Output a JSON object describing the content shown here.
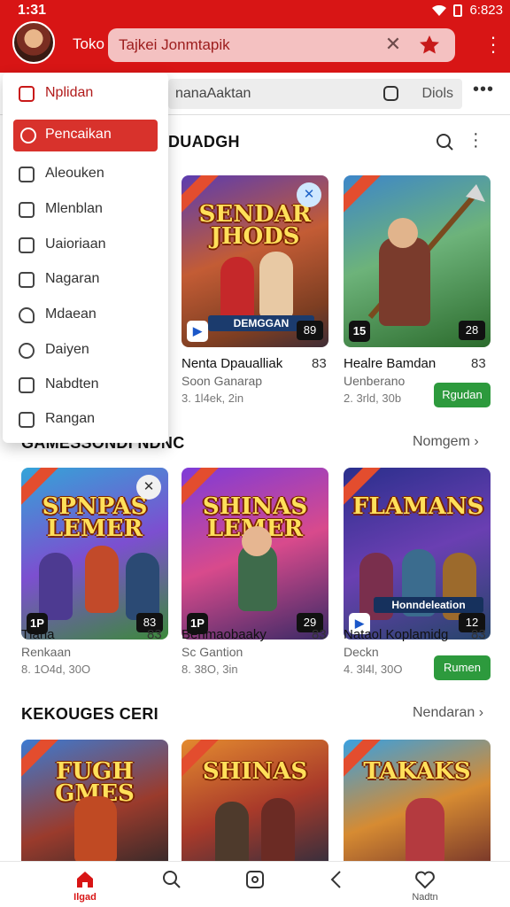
{
  "status": {
    "time": "1:31",
    "battery": "6:823"
  },
  "header": {
    "title": "Toko",
    "search_value": "Tajkei Jonmtapik",
    "clear_icon": "close-icon",
    "action_icon": "bookmark-star-icon"
  },
  "toolbar2": {
    "filter_value": "nanaAaktan",
    "filter_label": "Diols"
  },
  "menu": {
    "items": [
      {
        "label": "Nplidan",
        "icon": "bag-icon"
      },
      {
        "label": "Pencaikan",
        "icon": "info-icon"
      },
      {
        "label": "Aleouken",
        "icon": "briefcase-icon"
      },
      {
        "label": "Mlenblan",
        "icon": "tag-icon"
      },
      {
        "label": "Uaioriaan",
        "icon": "list-icon"
      },
      {
        "label": "Nagaran",
        "icon": "document-icon"
      },
      {
        "label": "Mdaean",
        "icon": "heart-icon"
      },
      {
        "label": "Daiyen",
        "icon": "camera-icon"
      },
      {
        "label": "Nabdten",
        "icon": "lock-icon"
      },
      {
        "label": "Rangan",
        "icon": "chat-icon"
      }
    ]
  },
  "sections": [
    {
      "title": "DUADGH",
      "link": "",
      "games": [
        {
          "art_title": "SENDAR JHODS",
          "art_sub": "DEMGGAN",
          "badge": "89",
          "name": "Nenta Dpaualliak",
          "icon_label": "83",
          "sub": "Soon Ganarap",
          "meta": "3. 1l4ek, 2in"
        },
        {
          "art_title": "",
          "art_sub": "",
          "badge": "28",
          "badge_left": "15",
          "name": "Healre Bamdan",
          "icon_label": "83",
          "sub": "Uenberano",
          "meta": "2. 3rld, 30b",
          "button": "Rgudan"
        }
      ]
    },
    {
      "title": "GAMESSONDI  NDNC",
      "link": "Nomgem",
      "games": [
        {
          "art_title": "SPNPAS LEMER",
          "art_sub": "",
          "badge": "83",
          "badge_left": "1P",
          "name": "Tlana",
          "icon_label": "83",
          "sub": "Renkaan",
          "meta": "8. 1O4d, 30O"
        },
        {
          "art_title": "SHINAS LEMER",
          "art_sub": "",
          "badge": "29",
          "badge_left": "1P",
          "name": "Behmaobaaky",
          "icon_label": "83",
          "sub": "Sc Gantion",
          "meta": "8. 38O, 3in"
        },
        {
          "art_title": "FLAMANS",
          "art_sub": "Honndeleation",
          "badge": "12",
          "name": "Nataol Koplamidg",
          "icon_label": "83",
          "sub": "Deckn",
          "meta": "4. 3l4l, 30O",
          "button": "Rumen"
        }
      ]
    },
    {
      "title": "KEKOUGES CERI",
      "link": "Nendaran",
      "games": [
        {
          "art_title": "FUGH GMES"
        },
        {
          "art_title": "SHINAS"
        },
        {
          "art_title": "TAKAKS"
        }
      ]
    }
  ],
  "bottom_nav": [
    {
      "label": "Ilgad",
      "icon": "home-icon"
    },
    {
      "label": "",
      "icon": "search-icon"
    },
    {
      "label": "",
      "icon": "square-icon"
    },
    {
      "label": "",
      "icon": "back-icon"
    },
    {
      "label": "Nadtn",
      "icon": "heart-icon"
    }
  ]
}
